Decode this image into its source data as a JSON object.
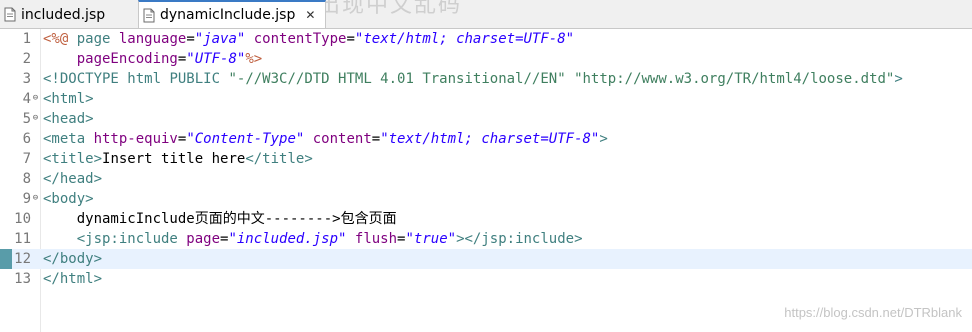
{
  "overlay_caption": "为什么包含页面出现中文乱码",
  "tabs": [
    {
      "label": "included.jsp",
      "active": false,
      "icon": "jsp-file-icon"
    },
    {
      "label": "dynamicInclude.jsp",
      "active": true,
      "icon": "jsp-file-icon",
      "close_glyph": "✕"
    }
  ],
  "colors": {
    "tag": "#3f7f7f",
    "attribute": "#7f007f",
    "value": "#2a00ff",
    "directive": "#bf5f3f",
    "current_line": "#e8f2fe",
    "active_tab_border": "#3a7ac5"
  },
  "editor": {
    "current_line": 12,
    "lines": [
      {
        "n": "1",
        "fold": "",
        "tokens": [
          {
            "t": "<%@ ",
            "c": "dir"
          },
          {
            "t": "page ",
            "c": "tag"
          },
          {
            "t": "language",
            "c": "attr"
          },
          {
            "t": "=",
            "c": "txt"
          },
          {
            "t": "\"java\"",
            "c": "val"
          },
          {
            "t": " contentType",
            "c": "attr"
          },
          {
            "t": "=",
            "c": "txt"
          },
          {
            "t": "\"text/html; charset=UTF-8\"",
            "c": "val"
          }
        ]
      },
      {
        "n": "2",
        "fold": "",
        "tokens": [
          {
            "t": "    pageEncoding",
            "c": "attr"
          },
          {
            "t": "=",
            "c": "txt"
          },
          {
            "t": "\"UTF-8\"",
            "c": "val"
          },
          {
            "t": "%>",
            "c": "dir"
          }
        ]
      },
      {
        "n": "3",
        "fold": "",
        "tokens": [
          {
            "t": "<!DOCTYPE ",
            "c": "doct"
          },
          {
            "t": "html ",
            "c": "tag"
          },
          {
            "t": "PUBLIC ",
            "c": "doct"
          },
          {
            "t": "\"-//W3C//DTD HTML 4.01 Transitional//EN\"",
            "c": "dstr"
          },
          {
            "t": " ",
            "c": "txt"
          },
          {
            "t": "\"http://www.w3.org/TR/html4/loose.dtd\"",
            "c": "dstr"
          },
          {
            "t": ">",
            "c": "doct"
          }
        ]
      },
      {
        "n": "4",
        "fold": "⊖",
        "tokens": [
          {
            "t": "<html>",
            "c": "tag"
          }
        ]
      },
      {
        "n": "5",
        "fold": "⊖",
        "tokens": [
          {
            "t": "<head>",
            "c": "tag"
          }
        ]
      },
      {
        "n": "6",
        "fold": "",
        "tokens": [
          {
            "t": "<meta ",
            "c": "tag"
          },
          {
            "t": "http-equiv",
            "c": "attr"
          },
          {
            "t": "=",
            "c": "txt"
          },
          {
            "t": "\"Content-Type\"",
            "c": "val"
          },
          {
            "t": " content",
            "c": "attr"
          },
          {
            "t": "=",
            "c": "txt"
          },
          {
            "t": "\"text/html; charset=UTF-8\"",
            "c": "val"
          },
          {
            "t": ">",
            "c": "tag"
          }
        ]
      },
      {
        "n": "7",
        "fold": "",
        "tokens": [
          {
            "t": "<title>",
            "c": "tag"
          },
          {
            "t": "Insert title here",
            "c": "txt"
          },
          {
            "t": "</title>",
            "c": "tag"
          }
        ]
      },
      {
        "n": "8",
        "fold": "",
        "tokens": [
          {
            "t": "</head>",
            "c": "tag"
          }
        ]
      },
      {
        "n": "9",
        "fold": "⊖",
        "tokens": [
          {
            "t": "<body>",
            "c": "tag"
          }
        ]
      },
      {
        "n": "10",
        "fold": "",
        "tokens": [
          {
            "t": "    dynamicInclude页面的中文-------->包含页面",
            "c": "txt"
          }
        ]
      },
      {
        "n": "11",
        "fold": "",
        "tokens": [
          {
            "t": "    <jsp:include ",
            "c": "tag"
          },
          {
            "t": "page",
            "c": "attr"
          },
          {
            "t": "=",
            "c": "txt"
          },
          {
            "t": "\"included.jsp\"",
            "c": "val"
          },
          {
            "t": " flush",
            "c": "attr"
          },
          {
            "t": "=",
            "c": "txt"
          },
          {
            "t": "\"true\"",
            "c": "val"
          },
          {
            "t": "></jsp:include>",
            "c": "tag"
          }
        ]
      },
      {
        "n": "12",
        "fold": "",
        "tokens": [
          {
            "t": "</body>",
            "c": "tag"
          }
        ]
      },
      {
        "n": "13",
        "fold": "",
        "tokens": [
          {
            "t": "</html>",
            "c": "tag"
          }
        ]
      }
    ]
  },
  "watermark": "https://blog.csdn.net/DTRblank"
}
